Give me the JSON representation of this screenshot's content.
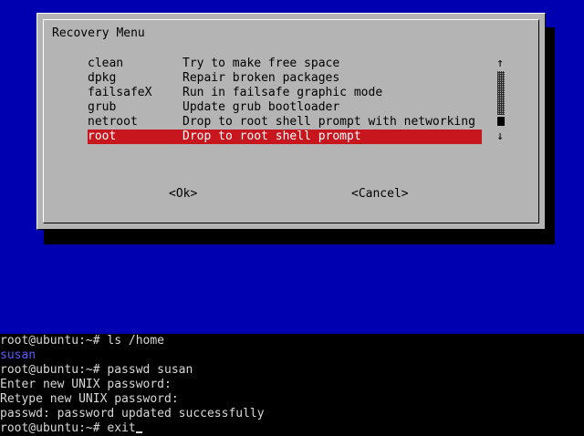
{
  "dialog": {
    "title": "Recovery Menu",
    "items": [
      {
        "key": "clean",
        "description": "Try to make free space"
      },
      {
        "key": "dpkg",
        "description": "Repair broken packages"
      },
      {
        "key": "failsafeX",
        "description": "Run in failsafe graphic mode"
      },
      {
        "key": "grub",
        "description": "Update grub bootloader"
      },
      {
        "key": "netroot",
        "description": "Drop to root shell prompt with networking"
      },
      {
        "key": "root",
        "description": "Drop to root shell prompt"
      }
    ],
    "selected_item": "root",
    "scroll": {
      "up_icon": "arrow-up-icon",
      "down_icon": "arrow-down-icon",
      "up_glyph": "↑",
      "down_glyph": "↓"
    },
    "ok_label": "<Ok>",
    "cancel_label": "<Cancel>"
  },
  "terminal": {
    "lines": [
      {
        "text": "root@ubuntu:~# ls /home",
        "color": "#d8d8d8"
      },
      {
        "text": "susan",
        "color": "#5a5aff"
      },
      {
        "text": "root@ubuntu:~# passwd susan",
        "color": "#d8d8d8"
      },
      {
        "text": "Enter new UNIX password:",
        "color": "#d8d8d8"
      },
      {
        "text": "Retype new UNIX password:",
        "color": "#d8d8d8"
      },
      {
        "text": "passwd: password updated successfully",
        "color": "#d8d8d8"
      },
      {
        "text": "root@ubuntu:~# exit",
        "color": "#d8d8d8"
      }
    ]
  },
  "colors": {
    "background_blue": "#0000b0",
    "dialog_gray": "#b4b4b4",
    "selection_red": "#c8161e",
    "terminal_black": "#000000"
  }
}
